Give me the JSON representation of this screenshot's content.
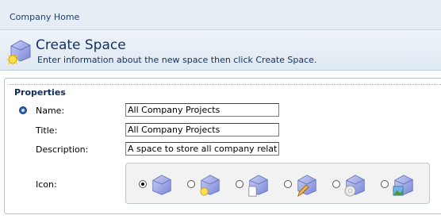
{
  "breadcrumb": {
    "label": "Company Home"
  },
  "header": {
    "title": "Create Space",
    "subtitle": "Enter information about the new space then click Create Space.",
    "icon": "create-space-icon"
  },
  "properties": {
    "title": "Properties",
    "name": {
      "label": "Name:",
      "value": "All Company Projects",
      "required": true
    },
    "title_field": {
      "label": "Title:",
      "value": "All Company Projects"
    },
    "description": {
      "label": "Description:",
      "value": "A space to store all company related pro"
    },
    "icon": {
      "label": "Icon:",
      "options": [
        {
          "icon": "space-icon",
          "selected": true
        },
        {
          "icon": "space-sun-icon",
          "selected": false
        },
        {
          "icon": "space-document-icon",
          "selected": false
        },
        {
          "icon": "space-pencil-icon",
          "selected": false
        },
        {
          "icon": "space-cd-icon",
          "selected": false
        },
        {
          "icon": "space-image-icon",
          "selected": false
        }
      ]
    }
  },
  "colors": {
    "title": "#14305c",
    "header_bg": "#e6edf5",
    "folder": "#9aa8e6"
  }
}
